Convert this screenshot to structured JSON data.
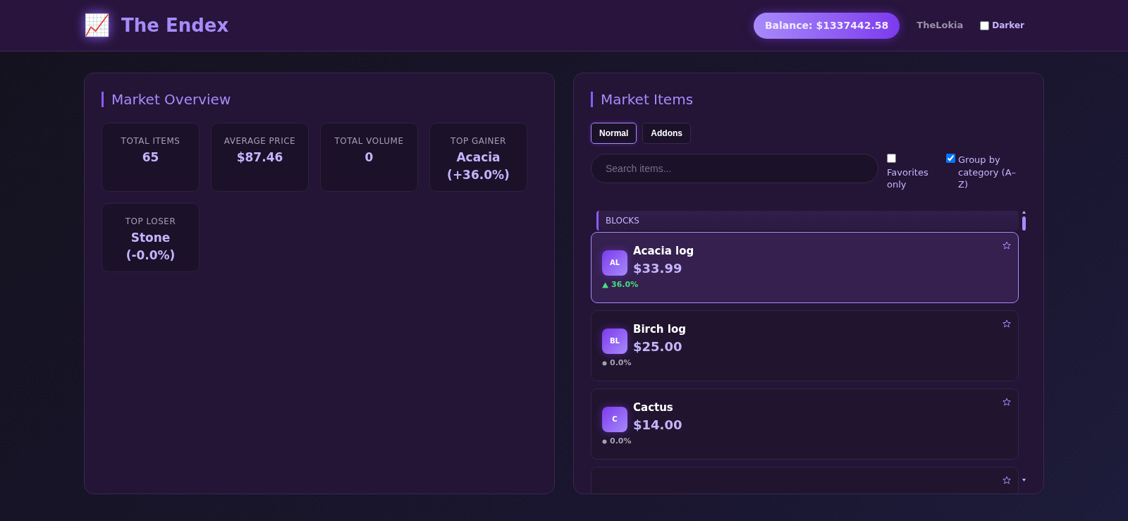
{
  "header": {
    "logo": "📈",
    "title": "The Endex",
    "balance": "Balance: $1337442.58",
    "username": "TheLokia",
    "darker": {
      "label": "Darker",
      "checked": false
    }
  },
  "overview": {
    "title": "Market Overview",
    "stats": [
      {
        "label": "TOTAL ITEMS",
        "value": "65"
      },
      {
        "label": "AVERAGE PRICE",
        "value": "$87.46"
      },
      {
        "label": "TOTAL VOLUME",
        "value": "0"
      },
      {
        "label": "TOP GAINER",
        "value": "Acacia (+36.0%)"
      },
      {
        "label": "TOP LOSER",
        "value": "Stone (-0.0%)"
      }
    ]
  },
  "market": {
    "title": "Market Items",
    "tabs": [
      {
        "label": "Normal",
        "selected": true
      },
      {
        "label": "Addons",
        "selected": false
      }
    ],
    "search": {
      "placeholder": "Search items..."
    },
    "filters": [
      {
        "label": "Favorites only",
        "checked": false
      },
      {
        "label": "Group by category (A–Z)",
        "checked": true
      }
    ],
    "category": "BLOCKS",
    "items": [
      {
        "initials": "AL",
        "name": "Acacia log",
        "price": "$33.99",
        "kind": "up",
        "change": "36.0%",
        "selected": true,
        "favorite": false
      },
      {
        "initials": "BL",
        "name": "Birch log",
        "price": "$25.00",
        "kind": "flat",
        "change": "0.0%",
        "selected": false,
        "favorite": false
      },
      {
        "initials": "C",
        "name": "Cactus",
        "price": "$14.00",
        "kind": "flat",
        "change": "0.0%",
        "selected": false,
        "favorite": false
      },
      {
        "selected": false,
        "favorite": false
      }
    ]
  }
}
